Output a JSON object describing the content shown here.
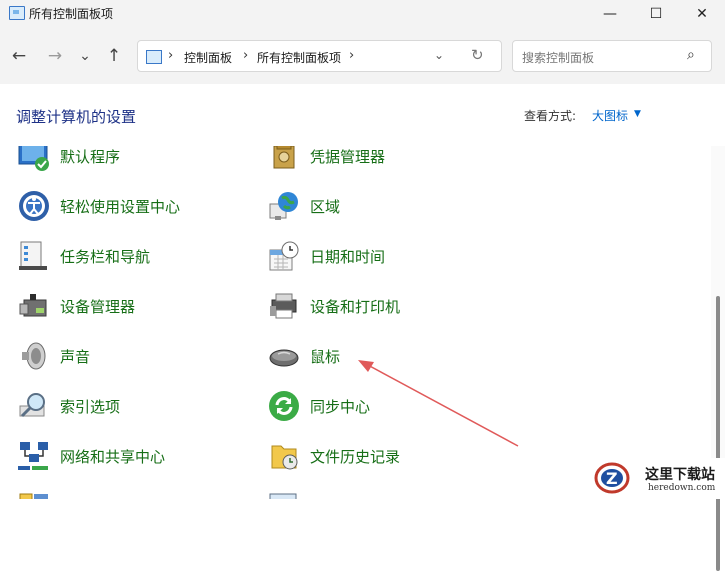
{
  "window": {
    "title": "所有控制面板项",
    "minimize": "—",
    "maximize": "☐",
    "close": "✕"
  },
  "nav": {
    "back": "←",
    "forward": "→",
    "history": "⌄",
    "up": "↑",
    "breadcrumb": [
      "控制面板",
      "所有控制面板项"
    ],
    "sep": "›",
    "dropdown": "⌄",
    "refresh": "↻"
  },
  "search": {
    "placeholder": "搜索控制面板",
    "icon": "⌕"
  },
  "header": {
    "title": "调整计算机的设置",
    "view_label": "查看方式:",
    "view_value": "大图标",
    "view_caret": "▼"
  },
  "items_left": [
    {
      "label": "默认程序",
      "icon": "default-programs-icon"
    },
    {
      "label": "轻松使用设置中心",
      "icon": "ease-of-access-icon"
    },
    {
      "label": "任务栏和导航",
      "icon": "taskbar-icon"
    },
    {
      "label": "设备管理器",
      "icon": "device-manager-icon"
    },
    {
      "label": "声音",
      "icon": "sound-icon"
    },
    {
      "label": "索引选项",
      "icon": "indexing-icon"
    },
    {
      "label": "网络和共享中心",
      "icon": "network-icon"
    },
    {
      "label": "",
      "icon": "partial-icon"
    }
  ],
  "items_right": [
    {
      "label": "凭据管理器",
      "icon": "credential-manager-icon"
    },
    {
      "label": "区域",
      "icon": "region-icon"
    },
    {
      "label": "日期和时间",
      "icon": "date-time-icon"
    },
    {
      "label": "设备和打印机",
      "icon": "devices-printers-icon"
    },
    {
      "label": "鼠标",
      "icon": "mouse-icon"
    },
    {
      "label": "同步中心",
      "icon": "sync-center-icon"
    },
    {
      "label": "文件历史记录",
      "icon": "file-history-icon"
    },
    {
      "label": "",
      "icon": "partial-icon"
    }
  ],
  "watermark": {
    "title": "这里下载站",
    "url": "heredown.com",
    "logo_letter": "Z"
  },
  "colors": {
    "item_label": "#166e16",
    "heading": "#1e3287",
    "link": "#0066cc",
    "arrow": "#e05a5a"
  }
}
